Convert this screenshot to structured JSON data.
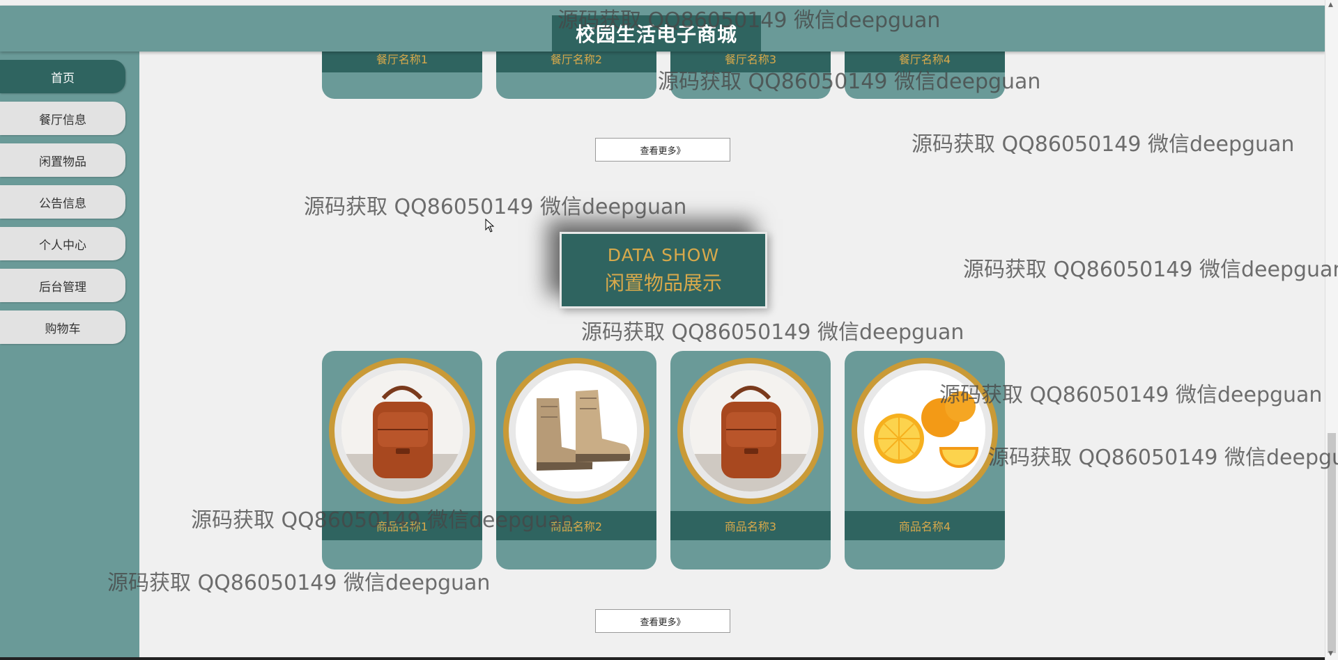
{
  "site": {
    "title": "校园生活电子商城"
  },
  "sidebar": {
    "items": [
      {
        "label": "首页",
        "active": true
      },
      {
        "label": "餐厅信息"
      },
      {
        "label": "闲置物品"
      },
      {
        "label": "公告信息"
      },
      {
        "label": "个人中心"
      },
      {
        "label": "后台管理"
      },
      {
        "label": "购物车"
      }
    ]
  },
  "restaurants": {
    "cards": [
      {
        "name": "餐厅名称1"
      },
      {
        "name": "餐厅名称2"
      },
      {
        "name": "餐厅名称3"
      },
      {
        "name": "餐厅名称4"
      }
    ],
    "more_label": "查看更多》"
  },
  "idle_items": {
    "title_en": "DATA SHOW",
    "title_cn": "闲置物品展示",
    "cards": [
      {
        "name": "商品名称1",
        "image": "leather-bag-icon"
      },
      {
        "name": "商品名称2",
        "image": "boots-icon"
      },
      {
        "name": "商品名称3",
        "image": "leather-bag-icon"
      },
      {
        "name": "商品名称4",
        "image": "oranges-icon"
      }
    ],
    "more_label": "查看更多》"
  },
  "watermark": {
    "text": "源码获取 QQ86050149 微信deepguan"
  },
  "colors": {
    "primary": "#6a9a98",
    "dark": "#2f6460",
    "accent": "#d8a94b",
    "ring": "#c99a37",
    "background": "#f0f0f0"
  }
}
